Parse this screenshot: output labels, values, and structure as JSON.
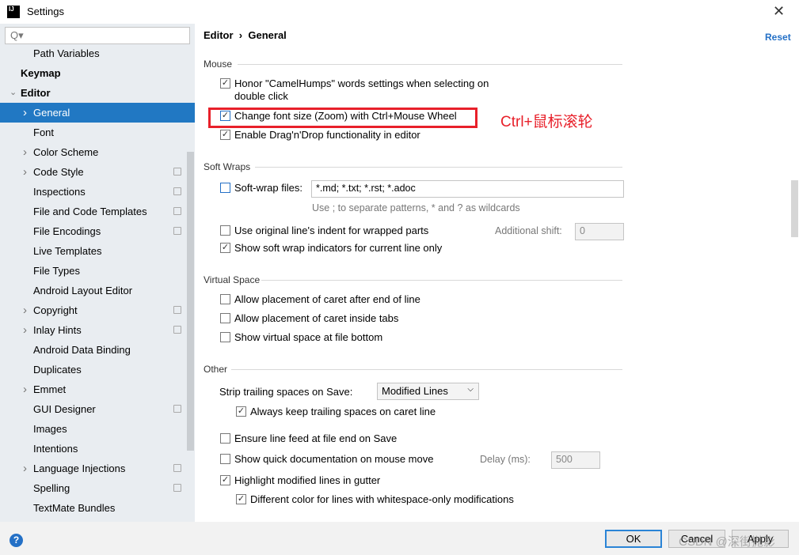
{
  "window": {
    "title": "Settings",
    "logo": "IJ"
  },
  "sidebar": {
    "search_placeholder": "Q▾",
    "items": [
      {
        "label": "Path Variables",
        "level": 2
      },
      {
        "label": "Keymap",
        "level": 0,
        "bold": true
      },
      {
        "label": "Editor",
        "level": 0,
        "bold": true,
        "expanded": true
      },
      {
        "label": "General",
        "level": 1,
        "arrow": true,
        "selected": true
      },
      {
        "label": "Font",
        "level": 1
      },
      {
        "label": "Color Scheme",
        "level": 1,
        "arrow": true
      },
      {
        "label": "Code Style",
        "level": 1,
        "arrow": true,
        "copy": true
      },
      {
        "label": "Inspections",
        "level": 1,
        "copy": true
      },
      {
        "label": "File and Code Templates",
        "level": 1,
        "copy": true
      },
      {
        "label": "File Encodings",
        "level": 1,
        "copy": true
      },
      {
        "label": "Live Templates",
        "level": 1
      },
      {
        "label": "File Types",
        "level": 1
      },
      {
        "label": "Android Layout Editor",
        "level": 1
      },
      {
        "label": "Copyright",
        "level": 1,
        "arrow": true,
        "copy": true
      },
      {
        "label": "Inlay Hints",
        "level": 1,
        "arrow": true,
        "copy": true
      },
      {
        "label": "Android Data Binding",
        "level": 1
      },
      {
        "label": "Duplicates",
        "level": 1
      },
      {
        "label": "Emmet",
        "level": 1,
        "arrow": true
      },
      {
        "label": "GUI Designer",
        "level": 1,
        "copy": true
      },
      {
        "label": "Images",
        "level": 1
      },
      {
        "label": "Intentions",
        "level": 1
      },
      {
        "label": "Language Injections",
        "level": 1,
        "arrow": true,
        "copy": true
      },
      {
        "label": "Spelling",
        "level": 1,
        "copy": true
      },
      {
        "label": "TextMate Bundles",
        "level": 1
      }
    ]
  },
  "main": {
    "breadcrumb": {
      "parent": "Editor",
      "sep": "›",
      "current": "General"
    },
    "reset": "Reset",
    "mouse": {
      "title": "Mouse",
      "camel1": "Honor \"CamelHumps\" words settings when selecting on",
      "camel2": "double click",
      "zoom": "Change font size (Zoom) with Ctrl+Mouse Wheel",
      "dnd": "Enable Drag'n'Drop functionality in editor"
    },
    "annotation": "Ctrl+鼠标滚轮",
    "soft": {
      "title": "Soft Wraps",
      "files_label": "Soft-wrap files:",
      "files_value": "*.md; *.txt; *.rst; *.adoc",
      "hint": "Use ; to separate patterns, * and ? as wildcards",
      "indent": "Use original line's indent for wrapped parts",
      "shift_label": "Additional shift:",
      "shift_value": "0",
      "indicators": "Show soft wrap indicators for current line only"
    },
    "virtual": {
      "title": "Virtual Space",
      "after_end": "Allow placement of caret after end of line",
      "inside_tabs": "Allow placement of caret inside tabs",
      "bottom": "Show virtual space at file bottom"
    },
    "other": {
      "title": "Other",
      "strip_label": "Strip trailing spaces on Save:",
      "strip_value": "Modified Lines",
      "keep": "Always keep trailing spaces on caret line",
      "linefeed": "Ensure line feed at file end on Save",
      "quickdoc": "Show quick documentation on mouse move",
      "delay_label": "Delay (ms):",
      "delay_value": "500",
      "highlight": "Highlight modified lines in gutter",
      "whitespace": "Different color for lines with whitespace-only modifications"
    }
  },
  "footer": {
    "help": "?",
    "ok": "OK",
    "cancel": "Cancel",
    "apply": "Apply",
    "watermark": "CSDN @深街抛影"
  }
}
